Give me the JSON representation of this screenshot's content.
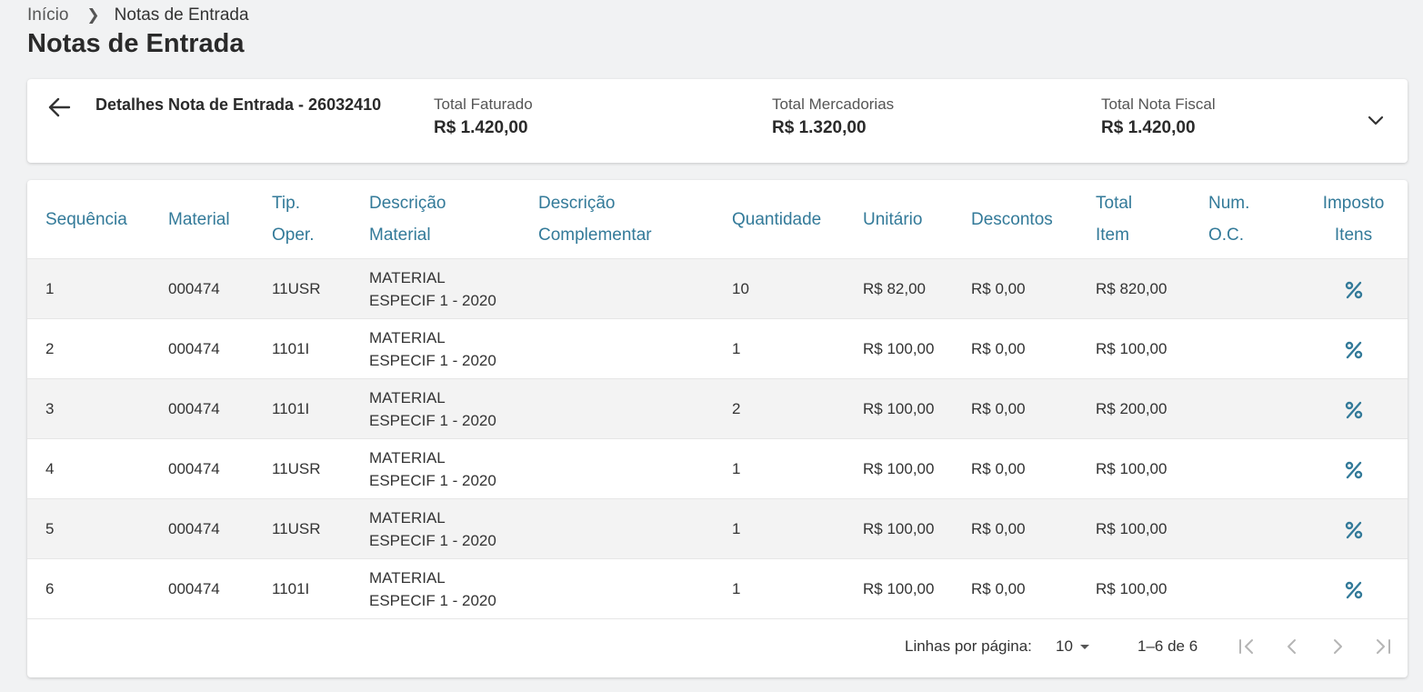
{
  "breadcrumb": {
    "home": "Início",
    "current": "Notas de Entrada"
  },
  "page_title": "Notas de Entrada",
  "summary": {
    "title": "Detalhes Nota de Entrada - 26032410",
    "stats": [
      {
        "label": "Total Faturado",
        "value": "R$ 1.420,00"
      },
      {
        "label": "Total Mercadorias",
        "value": "R$ 1.320,00"
      },
      {
        "label": "Total Nota Fiscal",
        "value": "R$ 1.420,00"
      }
    ]
  },
  "table": {
    "headers": {
      "sequencia": "Sequência",
      "material": "Material",
      "tip_oper": [
        "Tip.",
        "Oper."
      ],
      "descricao_material": [
        "Descrição",
        "Material"
      ],
      "descricao_complementar": [
        "Descrição",
        "Complementar"
      ],
      "quantidade": "Quantidade",
      "unitario": "Unitário",
      "descontos": "Descontos",
      "total_item": [
        "Total",
        "Item"
      ],
      "num_oc": [
        "Num.",
        "O.C."
      ],
      "imposto_itens": [
        "Imposto",
        "Itens"
      ]
    },
    "rows": [
      {
        "seq": "1",
        "material": "000474",
        "tip_oper": "11USR",
        "desc": [
          "MATERIAL",
          "ESPECIF 1 - 2020"
        ],
        "desc_comp": "",
        "qtd": "10",
        "unitario": "R$ 82,00",
        "descontos": "R$ 0,00",
        "total": "R$ 820,00",
        "num_oc": ""
      },
      {
        "seq": "2",
        "material": "000474",
        "tip_oper": "1101I",
        "desc": [
          "MATERIAL",
          "ESPECIF 1 - 2020"
        ],
        "desc_comp": "",
        "qtd": "1",
        "unitario": "R$ 100,00",
        "descontos": "R$ 0,00",
        "total": "R$ 100,00",
        "num_oc": ""
      },
      {
        "seq": "3",
        "material": "000474",
        "tip_oper": "1101I",
        "desc": [
          "MATERIAL",
          "ESPECIF 1 - 2020"
        ],
        "desc_comp": "",
        "qtd": "2",
        "unitario": "R$ 100,00",
        "descontos": "R$ 0,00",
        "total": "R$ 200,00",
        "num_oc": ""
      },
      {
        "seq": "4",
        "material": "000474",
        "tip_oper": "11USR",
        "desc": [
          "MATERIAL",
          "ESPECIF 1 - 2020"
        ],
        "desc_comp": "",
        "qtd": "1",
        "unitario": "R$ 100,00",
        "descontos": "R$ 0,00",
        "total": "R$ 100,00",
        "num_oc": ""
      },
      {
        "seq": "5",
        "material": "000474",
        "tip_oper": "11USR",
        "desc": [
          "MATERIAL",
          "ESPECIF 1 - 2020"
        ],
        "desc_comp": "",
        "qtd": "1",
        "unitario": "R$ 100,00",
        "descontos": "R$ 0,00",
        "total": "R$ 100,00",
        "num_oc": ""
      },
      {
        "seq": "6",
        "material": "000474",
        "tip_oper": "1101I",
        "desc": [
          "MATERIAL",
          "ESPECIF 1 - 2020"
        ],
        "desc_comp": "",
        "qtd": "1",
        "unitario": "R$ 100,00",
        "descontos": "R$ 0,00",
        "total": "R$ 100,00",
        "num_oc": ""
      }
    ]
  },
  "pagination": {
    "rows_label": "Linhas por página:",
    "rows_value": "10",
    "range": "1–6 de 6"
  },
  "icons": {
    "back": "arrow-left-icon",
    "expand": "chevron-down-icon",
    "tax": "percent-icon",
    "first_page": "first-page-icon",
    "prev_page": "chevron-left-icon",
    "next_page": "chevron-right-icon",
    "last_page": "last-page-icon"
  },
  "colors": {
    "accent": "#337a99",
    "background": "#f1f2f3",
    "row_stripe": "#f3f3f3"
  }
}
